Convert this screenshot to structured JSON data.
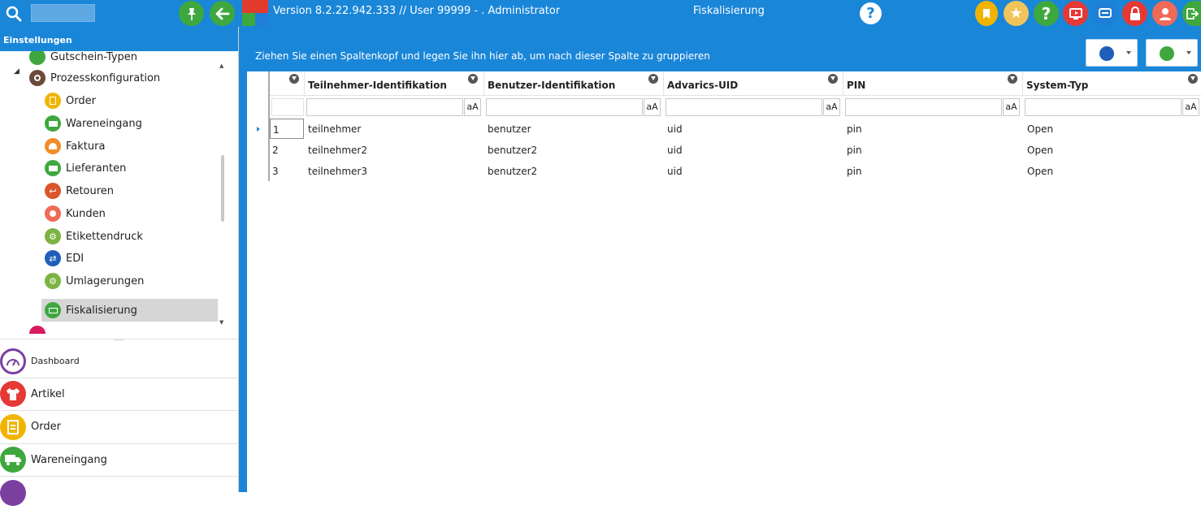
{
  "topbar": {
    "version_text": "Version 8.2.22.942.333  //  User 99999 - . Administrator",
    "page_title": "Fiskalisierung"
  },
  "sidebar": {
    "header": "Einstellungen",
    "tree": [
      {
        "label": "Gutschein-Typen",
        "icon": "gift-icon",
        "color": "#3ea83e"
      },
      {
        "label": "Prozesskonfiguration",
        "icon": "gear-icon",
        "color": "#6b4a3a"
      },
      {
        "label": "Order",
        "icon": "order-icon",
        "color": "#f0b400"
      },
      {
        "label": "Wareneingang",
        "icon": "truck-icon",
        "color": "#3ea83e"
      },
      {
        "label": "Faktura",
        "icon": "people-icon",
        "color": "#f28c28"
      },
      {
        "label": "Lieferanten",
        "icon": "truck-icon",
        "color": "#3ea83e"
      },
      {
        "label": "Retouren",
        "icon": "return-icon",
        "color": "#d9552b"
      },
      {
        "label": "Kunden",
        "icon": "person-icon",
        "color": "#f06a55"
      },
      {
        "label": "Etikettendruck",
        "icon": "gears-icon",
        "color": "#7cb342"
      },
      {
        "label": "EDI",
        "icon": "exchange-icon",
        "color": "#1f5fb8"
      },
      {
        "label": "Umlagerungen",
        "icon": "gears-icon",
        "color": "#7cb342"
      },
      {
        "label": "Fiskalisierung",
        "icon": "money-icon",
        "color": "#3ea83e"
      }
    ],
    "nav": [
      {
        "label": "Dashboard",
        "icon": "gauge-icon",
        "color": "#7b3fa0"
      },
      {
        "label": "Artikel",
        "icon": "shirt-icon",
        "color": "#e53935"
      },
      {
        "label": "Order",
        "icon": "order-icon",
        "color": "#f0b400"
      },
      {
        "label": "Wareneingang",
        "icon": "truck-icon",
        "color": "#3ea83e"
      }
    ]
  },
  "main": {
    "group_hint": "Ziehen Sie einen Spaltenkopf und legen Sie ihn hier ab, um nach dieser Spalte zu gruppieren",
    "columns": [
      "Teilnehmer-Identifikation",
      "Benutzer-Identifikation",
      "Advarics-UID",
      "PIN",
      "System-Typ"
    ],
    "case_label": "aA",
    "rows": [
      {
        "id": "1",
        "teilnehmer": "teilnehmer",
        "benutzer": "benutzer",
        "uid": "uid",
        "pin": "pin",
        "system": "Open"
      },
      {
        "id": "2",
        "teilnehmer": "teilnehmer2",
        "benutzer": "benutzer2",
        "uid": "uid",
        "pin": "pin",
        "system": "Open"
      },
      {
        "id": "3",
        "teilnehmer": "teilnehmer3",
        "benutzer": "benutzer2",
        "uid": "uid",
        "pin": "pin",
        "system": "Open"
      }
    ]
  },
  "colors": {
    "accent": "#1a86d8",
    "selected_row": "#d6d6d6"
  }
}
